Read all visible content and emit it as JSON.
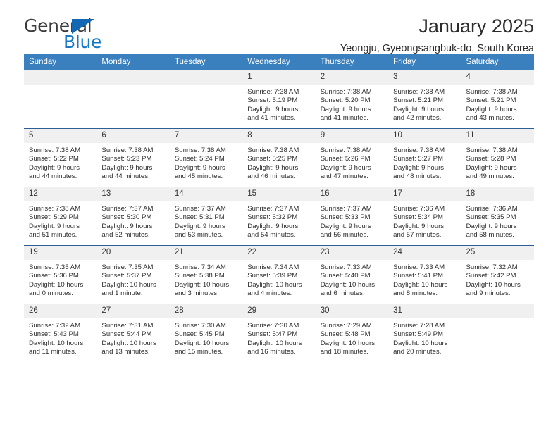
{
  "brand": {
    "name_top": "General",
    "name_bottom": "Blue",
    "accent_color": "#1779c4",
    "triangle_color": "#1268b3"
  },
  "header": {
    "title": "January 2025",
    "subtitle": "Yeongju, Gyeongsangbuk-do, South Korea",
    "header_bg": "#3a7fbe",
    "row_border": "#2d5f94",
    "daynum_bg": "#f0f0f0"
  },
  "calendar": {
    "weekday_headers": [
      "Sunday",
      "Monday",
      "Tuesday",
      "Wednesday",
      "Thursday",
      "Friday",
      "Saturday"
    ],
    "labels": {
      "sunrise_prefix": "Sunrise:",
      "sunset_prefix": "Sunset:",
      "daylight_prefix": "Daylight:"
    },
    "weeks": [
      [
        {
          "day": "",
          "empty": true,
          "sunrise": "",
          "sunset": "",
          "daylight_line1": "",
          "daylight_line2": ""
        },
        {
          "day": "",
          "empty": true,
          "sunrise": "",
          "sunset": "",
          "daylight_line1": "",
          "daylight_line2": ""
        },
        {
          "day": "",
          "empty": true,
          "sunrise": "",
          "sunset": "",
          "daylight_line1": "",
          "daylight_line2": ""
        },
        {
          "day": "1",
          "empty": false,
          "sunrise": "Sunrise: 7:38 AM",
          "sunset": "Sunset: 5:19 PM",
          "daylight_line1": "Daylight: 9 hours",
          "daylight_line2": "and 41 minutes."
        },
        {
          "day": "2",
          "empty": false,
          "sunrise": "Sunrise: 7:38 AM",
          "sunset": "Sunset: 5:20 PM",
          "daylight_line1": "Daylight: 9 hours",
          "daylight_line2": "and 41 minutes."
        },
        {
          "day": "3",
          "empty": false,
          "sunrise": "Sunrise: 7:38 AM",
          "sunset": "Sunset: 5:21 PM",
          "daylight_line1": "Daylight: 9 hours",
          "daylight_line2": "and 42 minutes."
        },
        {
          "day": "4",
          "empty": false,
          "sunrise": "Sunrise: 7:38 AM",
          "sunset": "Sunset: 5:21 PM",
          "daylight_line1": "Daylight: 9 hours",
          "daylight_line2": "and 43 minutes."
        }
      ],
      [
        {
          "day": "5",
          "empty": false,
          "sunrise": "Sunrise: 7:38 AM",
          "sunset": "Sunset: 5:22 PM",
          "daylight_line1": "Daylight: 9 hours",
          "daylight_line2": "and 44 minutes."
        },
        {
          "day": "6",
          "empty": false,
          "sunrise": "Sunrise: 7:38 AM",
          "sunset": "Sunset: 5:23 PM",
          "daylight_line1": "Daylight: 9 hours",
          "daylight_line2": "and 44 minutes."
        },
        {
          "day": "7",
          "empty": false,
          "sunrise": "Sunrise: 7:38 AM",
          "sunset": "Sunset: 5:24 PM",
          "daylight_line1": "Daylight: 9 hours",
          "daylight_line2": "and 45 minutes."
        },
        {
          "day": "8",
          "empty": false,
          "sunrise": "Sunrise: 7:38 AM",
          "sunset": "Sunset: 5:25 PM",
          "daylight_line1": "Daylight: 9 hours",
          "daylight_line2": "and 46 minutes."
        },
        {
          "day": "9",
          "empty": false,
          "sunrise": "Sunrise: 7:38 AM",
          "sunset": "Sunset: 5:26 PM",
          "daylight_line1": "Daylight: 9 hours",
          "daylight_line2": "and 47 minutes."
        },
        {
          "day": "10",
          "empty": false,
          "sunrise": "Sunrise: 7:38 AM",
          "sunset": "Sunset: 5:27 PM",
          "daylight_line1": "Daylight: 9 hours",
          "daylight_line2": "and 48 minutes."
        },
        {
          "day": "11",
          "empty": false,
          "sunrise": "Sunrise: 7:38 AM",
          "sunset": "Sunset: 5:28 PM",
          "daylight_line1": "Daylight: 9 hours",
          "daylight_line2": "and 49 minutes."
        }
      ],
      [
        {
          "day": "12",
          "empty": false,
          "sunrise": "Sunrise: 7:38 AM",
          "sunset": "Sunset: 5:29 PM",
          "daylight_line1": "Daylight: 9 hours",
          "daylight_line2": "and 51 minutes."
        },
        {
          "day": "13",
          "empty": false,
          "sunrise": "Sunrise: 7:37 AM",
          "sunset": "Sunset: 5:30 PM",
          "daylight_line1": "Daylight: 9 hours",
          "daylight_line2": "and 52 minutes."
        },
        {
          "day": "14",
          "empty": false,
          "sunrise": "Sunrise: 7:37 AM",
          "sunset": "Sunset: 5:31 PM",
          "daylight_line1": "Daylight: 9 hours",
          "daylight_line2": "and 53 minutes."
        },
        {
          "day": "15",
          "empty": false,
          "sunrise": "Sunrise: 7:37 AM",
          "sunset": "Sunset: 5:32 PM",
          "daylight_line1": "Daylight: 9 hours",
          "daylight_line2": "and 54 minutes."
        },
        {
          "day": "16",
          "empty": false,
          "sunrise": "Sunrise: 7:37 AM",
          "sunset": "Sunset: 5:33 PM",
          "daylight_line1": "Daylight: 9 hours",
          "daylight_line2": "and 56 minutes."
        },
        {
          "day": "17",
          "empty": false,
          "sunrise": "Sunrise: 7:36 AM",
          "sunset": "Sunset: 5:34 PM",
          "daylight_line1": "Daylight: 9 hours",
          "daylight_line2": "and 57 minutes."
        },
        {
          "day": "18",
          "empty": false,
          "sunrise": "Sunrise: 7:36 AM",
          "sunset": "Sunset: 5:35 PM",
          "daylight_line1": "Daylight: 9 hours",
          "daylight_line2": "and 58 minutes."
        }
      ],
      [
        {
          "day": "19",
          "empty": false,
          "sunrise": "Sunrise: 7:35 AM",
          "sunset": "Sunset: 5:36 PM",
          "daylight_line1": "Daylight: 10 hours",
          "daylight_line2": "and 0 minutes."
        },
        {
          "day": "20",
          "empty": false,
          "sunrise": "Sunrise: 7:35 AM",
          "sunset": "Sunset: 5:37 PM",
          "daylight_line1": "Daylight: 10 hours",
          "daylight_line2": "and 1 minute."
        },
        {
          "day": "21",
          "empty": false,
          "sunrise": "Sunrise: 7:34 AM",
          "sunset": "Sunset: 5:38 PM",
          "daylight_line1": "Daylight: 10 hours",
          "daylight_line2": "and 3 minutes."
        },
        {
          "day": "22",
          "empty": false,
          "sunrise": "Sunrise: 7:34 AM",
          "sunset": "Sunset: 5:39 PM",
          "daylight_line1": "Daylight: 10 hours",
          "daylight_line2": "and 4 minutes."
        },
        {
          "day": "23",
          "empty": false,
          "sunrise": "Sunrise: 7:33 AM",
          "sunset": "Sunset: 5:40 PM",
          "daylight_line1": "Daylight: 10 hours",
          "daylight_line2": "and 6 minutes."
        },
        {
          "day": "24",
          "empty": false,
          "sunrise": "Sunrise: 7:33 AM",
          "sunset": "Sunset: 5:41 PM",
          "daylight_line1": "Daylight: 10 hours",
          "daylight_line2": "and 8 minutes."
        },
        {
          "day": "25",
          "empty": false,
          "sunrise": "Sunrise: 7:32 AM",
          "sunset": "Sunset: 5:42 PM",
          "daylight_line1": "Daylight: 10 hours",
          "daylight_line2": "and 9 minutes."
        }
      ],
      [
        {
          "day": "26",
          "empty": false,
          "sunrise": "Sunrise: 7:32 AM",
          "sunset": "Sunset: 5:43 PM",
          "daylight_line1": "Daylight: 10 hours",
          "daylight_line2": "and 11 minutes."
        },
        {
          "day": "27",
          "empty": false,
          "sunrise": "Sunrise: 7:31 AM",
          "sunset": "Sunset: 5:44 PM",
          "daylight_line1": "Daylight: 10 hours",
          "daylight_line2": "and 13 minutes."
        },
        {
          "day": "28",
          "empty": false,
          "sunrise": "Sunrise: 7:30 AM",
          "sunset": "Sunset: 5:45 PM",
          "daylight_line1": "Daylight: 10 hours",
          "daylight_line2": "and 15 minutes."
        },
        {
          "day": "29",
          "empty": false,
          "sunrise": "Sunrise: 7:30 AM",
          "sunset": "Sunset: 5:47 PM",
          "daylight_line1": "Daylight: 10 hours",
          "daylight_line2": "and 16 minutes."
        },
        {
          "day": "30",
          "empty": false,
          "sunrise": "Sunrise: 7:29 AM",
          "sunset": "Sunset: 5:48 PM",
          "daylight_line1": "Daylight: 10 hours",
          "daylight_line2": "and 18 minutes."
        },
        {
          "day": "31",
          "empty": false,
          "sunrise": "Sunrise: 7:28 AM",
          "sunset": "Sunset: 5:49 PM",
          "daylight_line1": "Daylight: 10 hours",
          "daylight_line2": "and 20 minutes."
        },
        {
          "day": "",
          "empty": true,
          "sunrise": "",
          "sunset": "",
          "daylight_line1": "",
          "daylight_line2": ""
        }
      ]
    ]
  }
}
